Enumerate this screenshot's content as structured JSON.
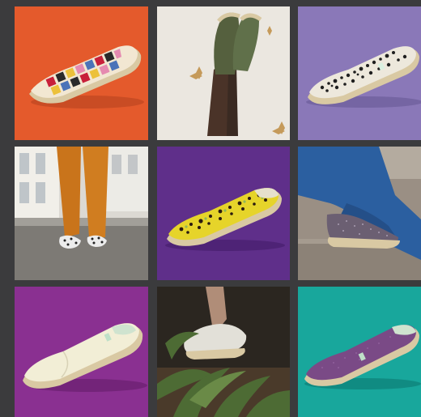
{
  "tiles": [
    {
      "name": "tile-multicolor-patchwork-espadrille",
      "background": "#e45a2c"
    },
    {
      "name": "tile-olive-espadrilles-legs-wall",
      "background": "#ebe7e0"
    },
    {
      "name": "tile-leopard-print-espadrille",
      "background": "#8a78b8"
    },
    {
      "name": "tile-orange-pants-street",
      "background": "#8e8b86"
    },
    {
      "name": "tile-yellow-pattern-espadrille",
      "background": "#5f2f8a"
    },
    {
      "name": "tile-blue-pants-purple-glitter",
      "background": "#9a8f84"
    },
    {
      "name": "tile-cream-espadrille-purple",
      "background": "#8a3091"
    },
    {
      "name": "tile-white-espadrille-plant",
      "background": "#2b2620"
    },
    {
      "name": "tile-purple-espadrille-teal",
      "background": "#18a79c"
    }
  ],
  "colors": {
    "page_background": "#3b3b3d",
    "sole_jute": "#d9c9a3"
  }
}
